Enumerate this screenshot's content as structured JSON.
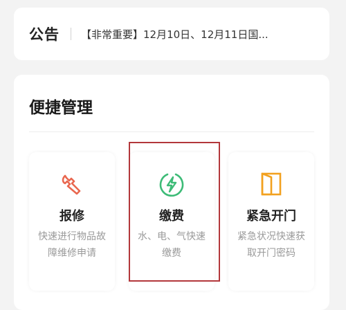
{
  "notice": {
    "logo": "公告",
    "text": "【非常重要】12月10日、12月11日国..."
  },
  "quick": {
    "title": "便捷管理",
    "tiles": [
      {
        "name": "repair",
        "title": "报修",
        "desc": "快速进行物品故障维修申请",
        "icon": "wrench-icon",
        "color": "#e9674f"
      },
      {
        "name": "payment",
        "title": "缴费",
        "desc": "水、电、气快速缴费",
        "icon": "lightning-icon",
        "color": "#3dbb77"
      },
      {
        "name": "emergency-door",
        "title": "紧急开门",
        "desc": "紧急状况快速获取开门密码",
        "icon": "door-icon",
        "color": "#f2a11f"
      }
    ]
  }
}
